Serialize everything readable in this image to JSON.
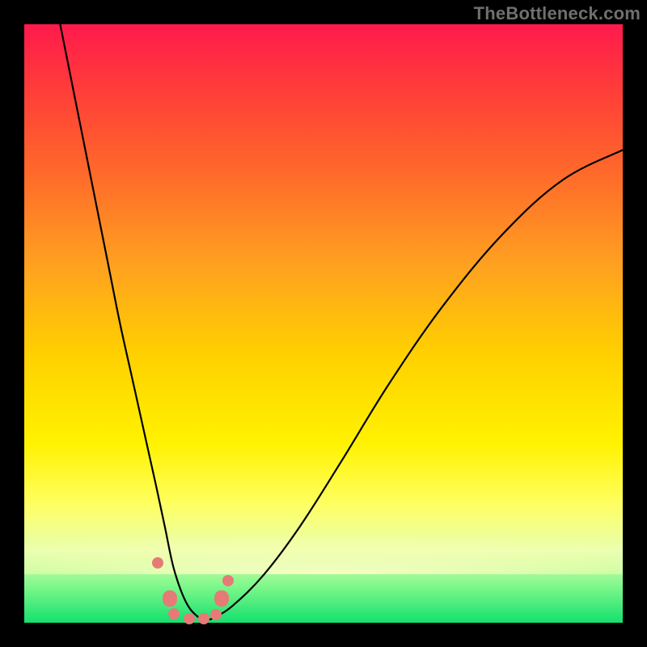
{
  "attribution": "TheBottleneck.com",
  "chart_data": {
    "type": "line",
    "title": "",
    "xlabel": "",
    "ylabel": "",
    "xlim": [
      0,
      100
    ],
    "ylim": [
      0,
      100
    ],
    "grid": false,
    "legend": false,
    "series": [
      {
        "name": "curve",
        "x": [
          6,
          8,
          10,
          12,
          14,
          16,
          18,
          20,
          22,
          23.5,
          25,
          27,
          29,
          30.5,
          32,
          35,
          40,
          46,
          53,
          61,
          70,
          80,
          90,
          100
        ],
        "y": [
          100,
          90,
          80,
          70,
          60,
          50,
          41,
          32,
          23,
          16,
          9,
          3.5,
          1,
          0.5,
          1,
          3,
          8,
          16,
          27,
          40,
          53,
          65,
          74,
          79
        ]
      }
    ],
    "points": [
      {
        "x": 22.3,
        "y": 10.0,
        "size": "normal"
      },
      {
        "x": 24.3,
        "y": 4.0,
        "size": "large"
      },
      {
        "x": 25.0,
        "y": 1.5,
        "size": "normal"
      },
      {
        "x": 27.5,
        "y": 0.7,
        "size": "normal"
      },
      {
        "x": 30.0,
        "y": 0.7,
        "size": "normal"
      },
      {
        "x": 32.0,
        "y": 1.3,
        "size": "normal"
      },
      {
        "x": 33.0,
        "y": 4.0,
        "size": "large"
      },
      {
        "x": 34.0,
        "y": 7.0,
        "size": "normal"
      }
    ],
    "background_gradient": {
      "top": "#ff1a4d",
      "upper_mid": "#ffa020",
      "mid": "#fff200",
      "lower_mid": "#ffff60",
      "bottom": "#14e06e"
    }
  }
}
